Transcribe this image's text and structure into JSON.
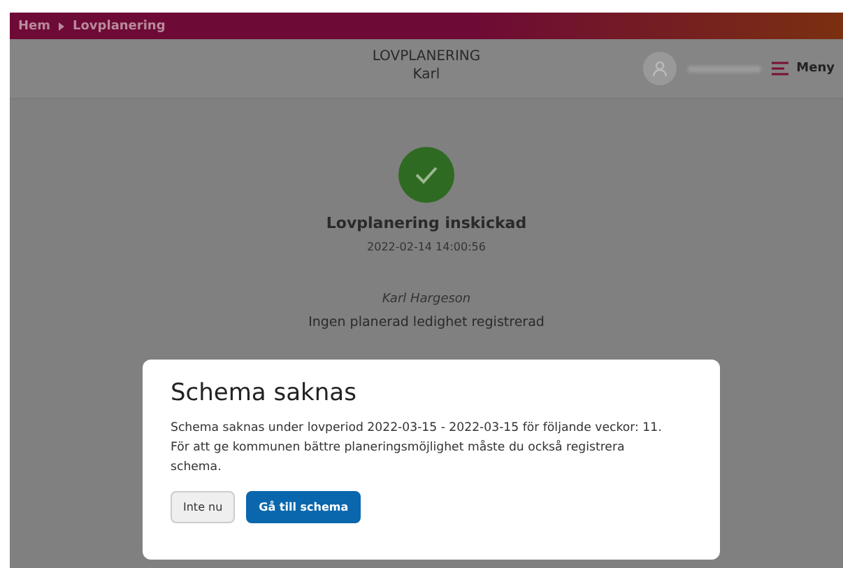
{
  "breadcrumb": [
    "Hem",
    "Lovplanering"
  ],
  "header": {
    "title": "LOVPLANERING",
    "subtitle": "Karl",
    "menu_label": "Meny"
  },
  "status": {
    "title": "Lovplanering inskickad",
    "timestamp": "2022-02-14 14:00:56",
    "person": "Karl Hargeson",
    "note": "Ingen planerad ledighet registrerad"
  },
  "dialog": {
    "title": "Schema saknas",
    "message": "Schema saknas under lovperiod 2022-03-15 - 2022-03-15 för följande veckor: 11. För att ge kommunen bättre planeringsmöjlighet måste du också registrera schema.",
    "buttons": [
      {
        "label": "Inte nu",
        "kind": "secondary"
      },
      {
        "label": "Gå till schema",
        "kind": "primary"
      }
    ]
  }
}
